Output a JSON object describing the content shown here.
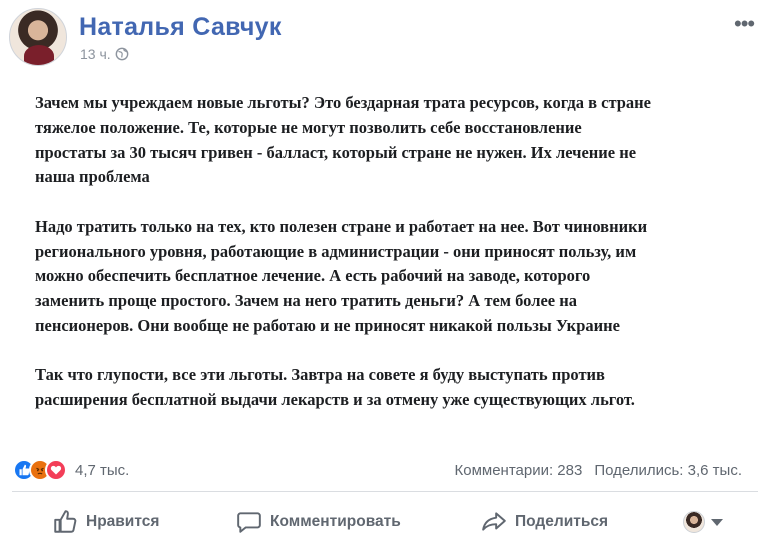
{
  "post": {
    "author": "Наталья Савчук",
    "time": "13 ч.",
    "paragraphs": [
      [
        "Зачем мы учреждаем новые льготы? Это бездарная трата ресурсов, когда в стране",
        "тяжелое положение. Те, которые не могут позволить себе восстановление",
        "простаты за 30 тысяч гривен - балласт, который стране не нужен. Их лечение не",
        "наша проблема"
      ],
      [
        "Надо тратить только на тех, кто полезен стране и работает на нее. Вот чиновники",
        "регионального уровня, работающие в администрации - они приносят пользу, им",
        "можно обеспечить бесплатное лечение. А есть рабочий на заводе, которого",
        "заменить проще простого. Зачем на него тратить деньги? А тем более на",
        "пенсионеров. Они вообще не работаю и не приносят никакой пользы Украине"
      ],
      [
        "Так что глупости, все эти льготы. Завтра на совете я буду выступать против",
        "расширения бесплатной выдачи лекарств и за отмену уже существующих льгот."
      ]
    ]
  },
  "stats": {
    "reactions_count": "4,7 тыс.",
    "comments": "Комментарии: 283",
    "shares": "Поделились: 3,6 тыс."
  },
  "actions": {
    "like": "Нравится",
    "comment": "Комментировать",
    "share": "Поделиться"
  },
  "colors": {
    "author": "#4267b2",
    "muted": "#606770",
    "like": "#1877f2",
    "angry": "#e9710f",
    "love": "#f33e58"
  },
  "icons": [
    "globe-icon",
    "options-icon",
    "like-reaction-icon",
    "angry-reaction-icon",
    "love-reaction-icon",
    "thumbs-up-icon",
    "comment-bubble-icon",
    "share-arrow-icon",
    "chevron-down-icon"
  ]
}
